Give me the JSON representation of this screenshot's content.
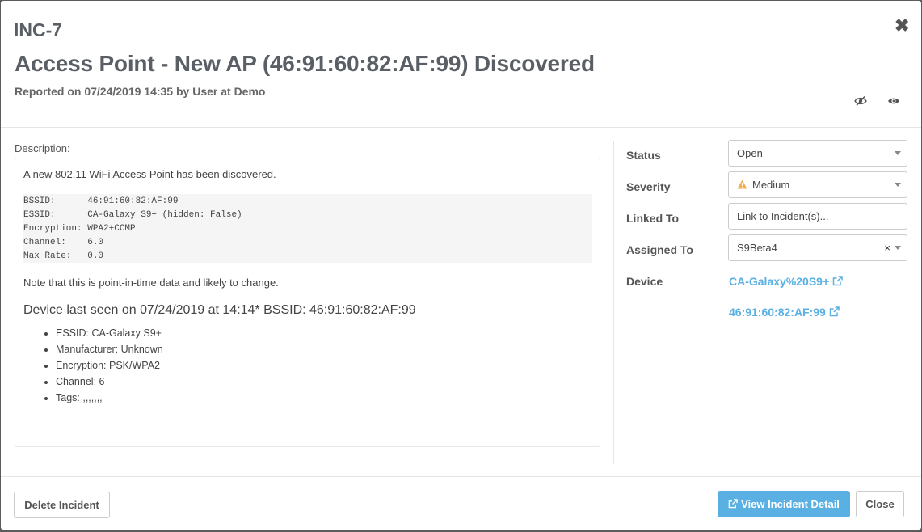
{
  "modal": {
    "incident_id": "INC-7",
    "title": "Access Point - New AP (46:91:60:82:AF:99) Discovered",
    "reported": "Reported on 07/24/2019 14:35 by User at Demo"
  },
  "icons": {
    "close": "close-icon",
    "hide": "eye-slash-icon",
    "watch": "eye-icon",
    "warning": "warning-icon",
    "external": "external-link-icon"
  },
  "description": {
    "label": "Description:",
    "intro": "A new 802.11 WiFi Access Point has been discovered.",
    "code_lines": [
      "BSSID:      46:91:60:82:AF:99",
      "ESSID:      CA-Galaxy S9+ (hidden: False)",
      "Encryption: WPA2+CCMP",
      "Channel:    6.0",
      "Max Rate:   0.0"
    ],
    "note": "Note that this is point-in-time data and likely to change.",
    "seen_heading": "Device last seen on 07/24/2019 at 14:14* BSSID: 46:91:60:82:AF:99",
    "details": [
      "ESSID: CA-Galaxy S9+",
      "Manufacturer: Unknown",
      "Encryption: PSK/WPA2",
      "Channel: 6",
      "Tags: ,,,,,,,"
    ]
  },
  "sidebar": {
    "status_label": "Status",
    "status_value": "Open",
    "severity_label": "Severity",
    "severity_value": "Medium",
    "linked_label": "Linked To",
    "linked_placeholder": "Link to Incident(s)...",
    "assigned_label": "Assigned To",
    "assigned_value": "S9Beta4",
    "assigned_clear": "×",
    "device_label": "Device",
    "device_links": [
      "CA-Galaxy%20S9+",
      "46:91:60:82:AF:99"
    ]
  },
  "footer": {
    "delete_label": "Delete Incident",
    "view_detail_label": "View Incident Detail",
    "close_label": "Close"
  },
  "colors": {
    "accent": "#5aafe3",
    "warning": "#f0ad4e",
    "backdrop": "#5c5c5c"
  }
}
